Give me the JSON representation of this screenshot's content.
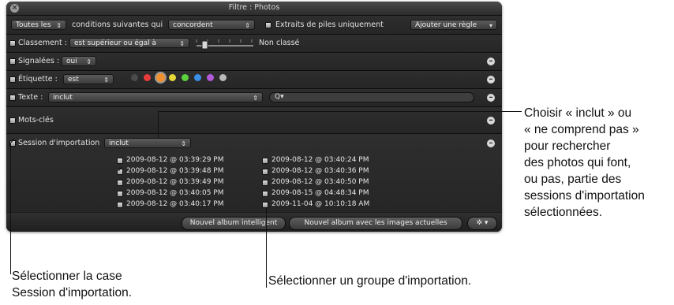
{
  "window": {
    "title": "Filtre : Photos",
    "close_icon": "close-icon"
  },
  "toolbar": {
    "scope": "Toutes les",
    "conditions_text": "conditions suivantes qui",
    "match": "concordent",
    "stack_picks": "Extraits de piles uniquement",
    "add_rule": "Ajouter une règle"
  },
  "rules": {
    "rating": {
      "label": "Classement :",
      "operator": "est supérieur ou égal à",
      "value": "Non classé",
      "checked": false
    },
    "flagged": {
      "label": "Signalées :",
      "value": "oui",
      "checked": false
    },
    "label": {
      "label": "Étiquette :",
      "operator": "est",
      "checked": false,
      "colors": [
        "#4a4a4a",
        "#e63c3c",
        "#f0902e",
        "#e6d83a",
        "#5ccf3d",
        "#3b8fe6",
        "#b45ad9",
        "#b9b9b9"
      ]
    },
    "text": {
      "label": "Texte :",
      "operator": "inclut",
      "search_placeholder": "Q▾",
      "checked": false
    },
    "keywords": {
      "label": "Mots-clés",
      "checked": false
    },
    "import_session": {
      "label": "Session d'importation",
      "operator": "inclut",
      "checked": true
    }
  },
  "sessions": {
    "col1": [
      {
        "date": "2009-08-12 @ 03:39:29 PM",
        "checked": false
      },
      {
        "date": "2009-08-12 @ 03:39:48 PM",
        "checked": true
      },
      {
        "date": "2009-08-12 @ 03:39:49 PM",
        "checked": false
      },
      {
        "date": "2009-08-12 @ 03:40:05 PM",
        "checked": false
      },
      {
        "date": "2009-08-12 @ 03:40:17 PM",
        "checked": false
      }
    ],
    "col2": [
      {
        "date": "2009-08-12 @ 03:40:24 PM",
        "checked": false
      },
      {
        "date": "2009-08-12 @ 03:40:36 PM",
        "checked": false
      },
      {
        "date": "2009-08-12 @ 03:40:50 PM",
        "checked": false
      },
      {
        "date": "2009-08-15 @ 04:48:34 PM",
        "checked": false
      },
      {
        "date": "2009-11-04 @ 10:10:18 AM",
        "checked": false
      }
    ]
  },
  "bottom": {
    "new_smart_album": "Nouvel album intelligent",
    "new_album_current": "Nouvel album avec les images actuelles",
    "action_menu": "✲ ▾"
  },
  "callouts": {
    "right": [
      "Choisir « inclut » ou",
      "« ne comprend pas »",
      "pour rechercher",
      "des photos qui font,",
      "ou pas, partie des",
      "sessions d'importation",
      "sélectionnées."
    ],
    "bottom_left": [
      "Sélectionner la case",
      "Session d'importation."
    ],
    "bottom_mid": "Sélectionner un groupe d'importation."
  }
}
